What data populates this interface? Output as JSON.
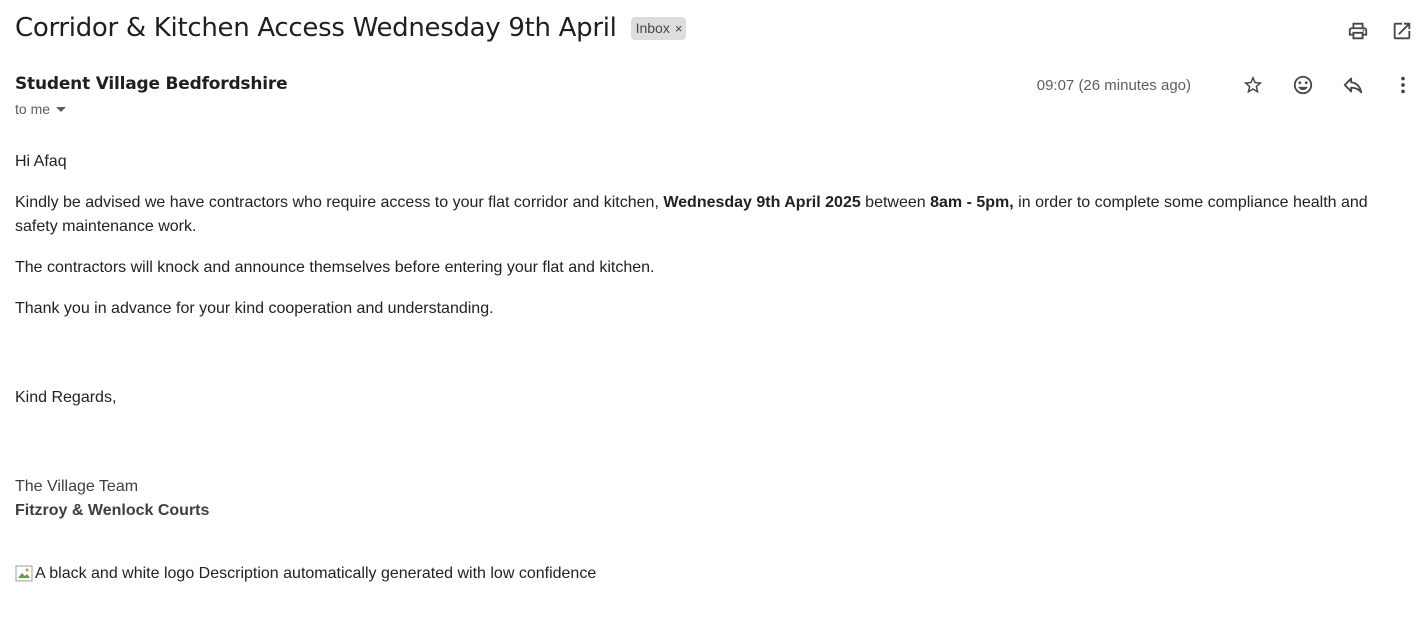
{
  "email": {
    "subject": "Corridor & Kitchen Access Wednesday 9th April",
    "label_chip": "Inbox",
    "label_chip_close": "×",
    "sender": "Student Village Bedfordshire",
    "recipient": "to me",
    "timestamp": "09:07 (26 minutes ago)"
  },
  "icons": {
    "print": "print-icon",
    "open_new_window": "open-in-new-window-icon",
    "star": "star-icon",
    "emoji": "emoji-reaction-icon",
    "reply": "reply-icon",
    "more": "more-vertical-icon"
  },
  "body": {
    "greeting": "Hi Afaq",
    "p1_a": "Kindly be advised we have contractors who require access to your flat corridor and kitchen, ",
    "p1_bold1": "Wednesday 9th April 2025",
    "p1_b": " between ",
    "p1_bold2": "8am - 5pm,",
    "p1_c": " in order to complete some compliance health and safety maintenance work.",
    "p2": "The contractors will knock and announce themselves before entering your flat and kitchen.",
    "p3": "Thank you in advance for your kind cooperation and understanding.",
    "closing": "Kind Regards,",
    "team": "The Village Team",
    "place": "Fitzroy & Wenlock Courts",
    "image_alt": "A black and white logo Description automatically generated with low confidence"
  }
}
